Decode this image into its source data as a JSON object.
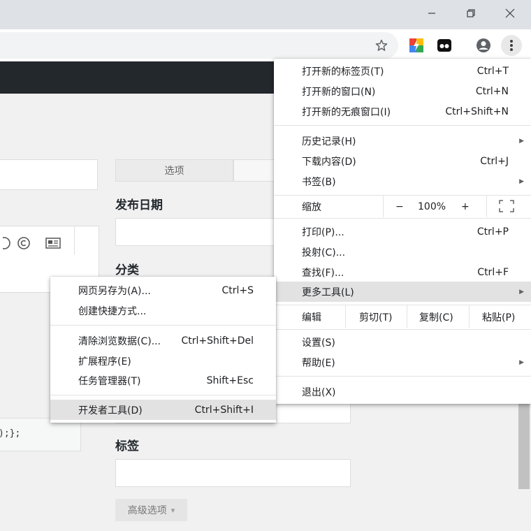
{
  "icons": {
    "minimize": "minimize-icon",
    "restore": "restore-icon",
    "close": "close-icon",
    "star": "star-icon",
    "ext1": "extension-icon",
    "ext2": "extension-icon",
    "profile": "profile-icon",
    "menu": "kebab-menu-icon"
  },
  "page": {
    "tabs": [
      "选项",
      ""
    ],
    "publish_date_title": "发布日期",
    "category_title": "分类",
    "tags_title": "标签",
    "advanced_label": "高级选项",
    "advanced_caret": "▾",
    "code_snippet": ");};"
  },
  "main_menu": {
    "new_tab": {
      "label": "打开新的标签页(T)",
      "shortcut": "Ctrl+T"
    },
    "new_window": {
      "label": "打开新的窗口(N)",
      "shortcut": "Ctrl+N"
    },
    "new_incognito": {
      "label": "打开新的无痕窗口(I)",
      "shortcut": "Ctrl+Shift+N"
    },
    "history": {
      "label": "历史记录(H)"
    },
    "downloads": {
      "label": "下载内容(D)",
      "shortcut": "Ctrl+J"
    },
    "bookmarks": {
      "label": "书签(B)"
    },
    "zoom": {
      "label": "缩放",
      "minus": "−",
      "value": "100%",
      "plus": "+"
    },
    "print": {
      "label": "打印(P)...",
      "shortcut": "Ctrl+P"
    },
    "cast": {
      "label": "投射(C)..."
    },
    "find": {
      "label": "查找(F)...",
      "shortcut": "Ctrl+F"
    },
    "more_tools": {
      "label": "更多工具(L)"
    },
    "edit": {
      "label": "编辑",
      "cut": "剪切(T)",
      "copy": "复制(C)",
      "paste": "粘贴(P)"
    },
    "settings": {
      "label": "设置(S)"
    },
    "help": {
      "label": "帮助(E)"
    },
    "exit": {
      "label": "退出(X)"
    }
  },
  "sub_menu": {
    "save_page": {
      "label": "网页另存为(A)...",
      "shortcut": "Ctrl+S"
    },
    "create_shortcut": {
      "label": "创建快捷方式..."
    },
    "clear_data": {
      "label": "清除浏览数据(C)...",
      "shortcut": "Ctrl+Shift+Del"
    },
    "extensions": {
      "label": "扩展程序(E)"
    },
    "task_manager": {
      "label": "任务管理器(T)",
      "shortcut": "Shift+Esc"
    },
    "dev_tools": {
      "label": "开发者工具(D)",
      "shortcut": "Ctrl+Shift+I"
    }
  },
  "arrow_glyph": "▶",
  "colors": {
    "highlight": "#e2e2e2",
    "titlebar": "#dee1e6",
    "darkbar": "#23282d"
  }
}
